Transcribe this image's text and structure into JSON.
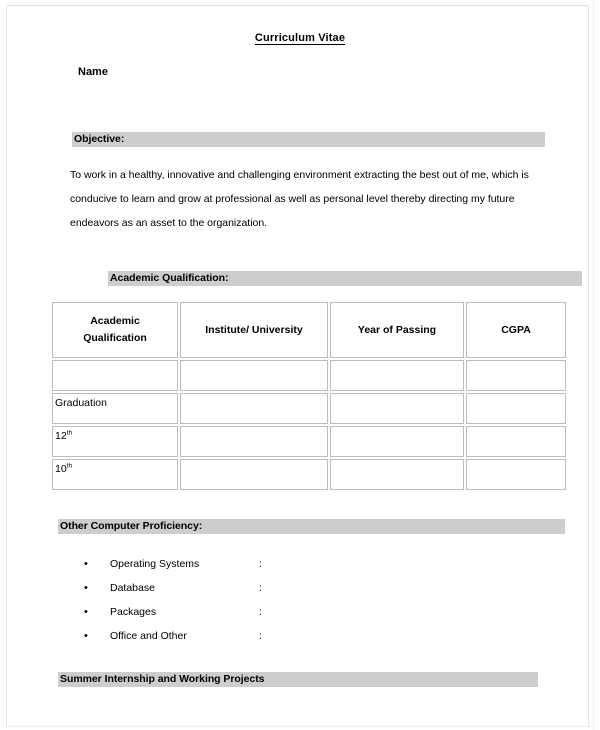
{
  "document": {
    "title": "Curriculum Vitae",
    "name_label": "Name"
  },
  "sections": {
    "objective": {
      "heading": "Objective:",
      "body": "To work in a healthy, innovative and challenging environment extracting the best out of me, which is conducive to learn and grow at professional as well as personal level thereby directing my future endeavors as an asset to the organization."
    },
    "academic": {
      "heading": "Academic Qualification:",
      "table": {
        "columns": [
          "Academic Qualification",
          "Institute/ University",
          "Year of Passing",
          "CGPA"
        ],
        "column_lines": [
          [
            "Academic",
            "Qualification"
          ],
          [
            "Institute/ University"
          ],
          [
            "Year of Passing"
          ],
          [
            "CGPA"
          ]
        ],
        "rows": [
          {
            "qualification": "",
            "qualification_sup": "",
            "institute": "",
            "year": "",
            "cgpa": ""
          },
          {
            "qualification": "Graduation",
            "qualification_sup": "",
            "institute": "",
            "year": "",
            "cgpa": ""
          },
          {
            "qualification": "12",
            "qualification_sup": "th",
            "institute": "",
            "year": "",
            "cgpa": ""
          },
          {
            "qualification": "10",
            "qualification_sup": "th",
            "institute": "",
            "year": "",
            "cgpa": ""
          }
        ]
      }
    },
    "proficiency": {
      "heading": "Other Computer Proficiency:",
      "bullet": "•",
      "separator": ":",
      "items": [
        {
          "label": "Operating Systems",
          "value": ""
        },
        {
          "label": "Database",
          "value": ""
        },
        {
          "label": "Packages",
          "value": ""
        },
        {
          "label": "Office and Other",
          "value": ""
        }
      ]
    },
    "internship": {
      "heading": "Summer Internship and Working Projects"
    }
  },
  "colors": {
    "highlight": "#cdcdcd",
    "text": "#000000",
    "table_border": "#bdbdbd",
    "page": "#ffffff"
  }
}
